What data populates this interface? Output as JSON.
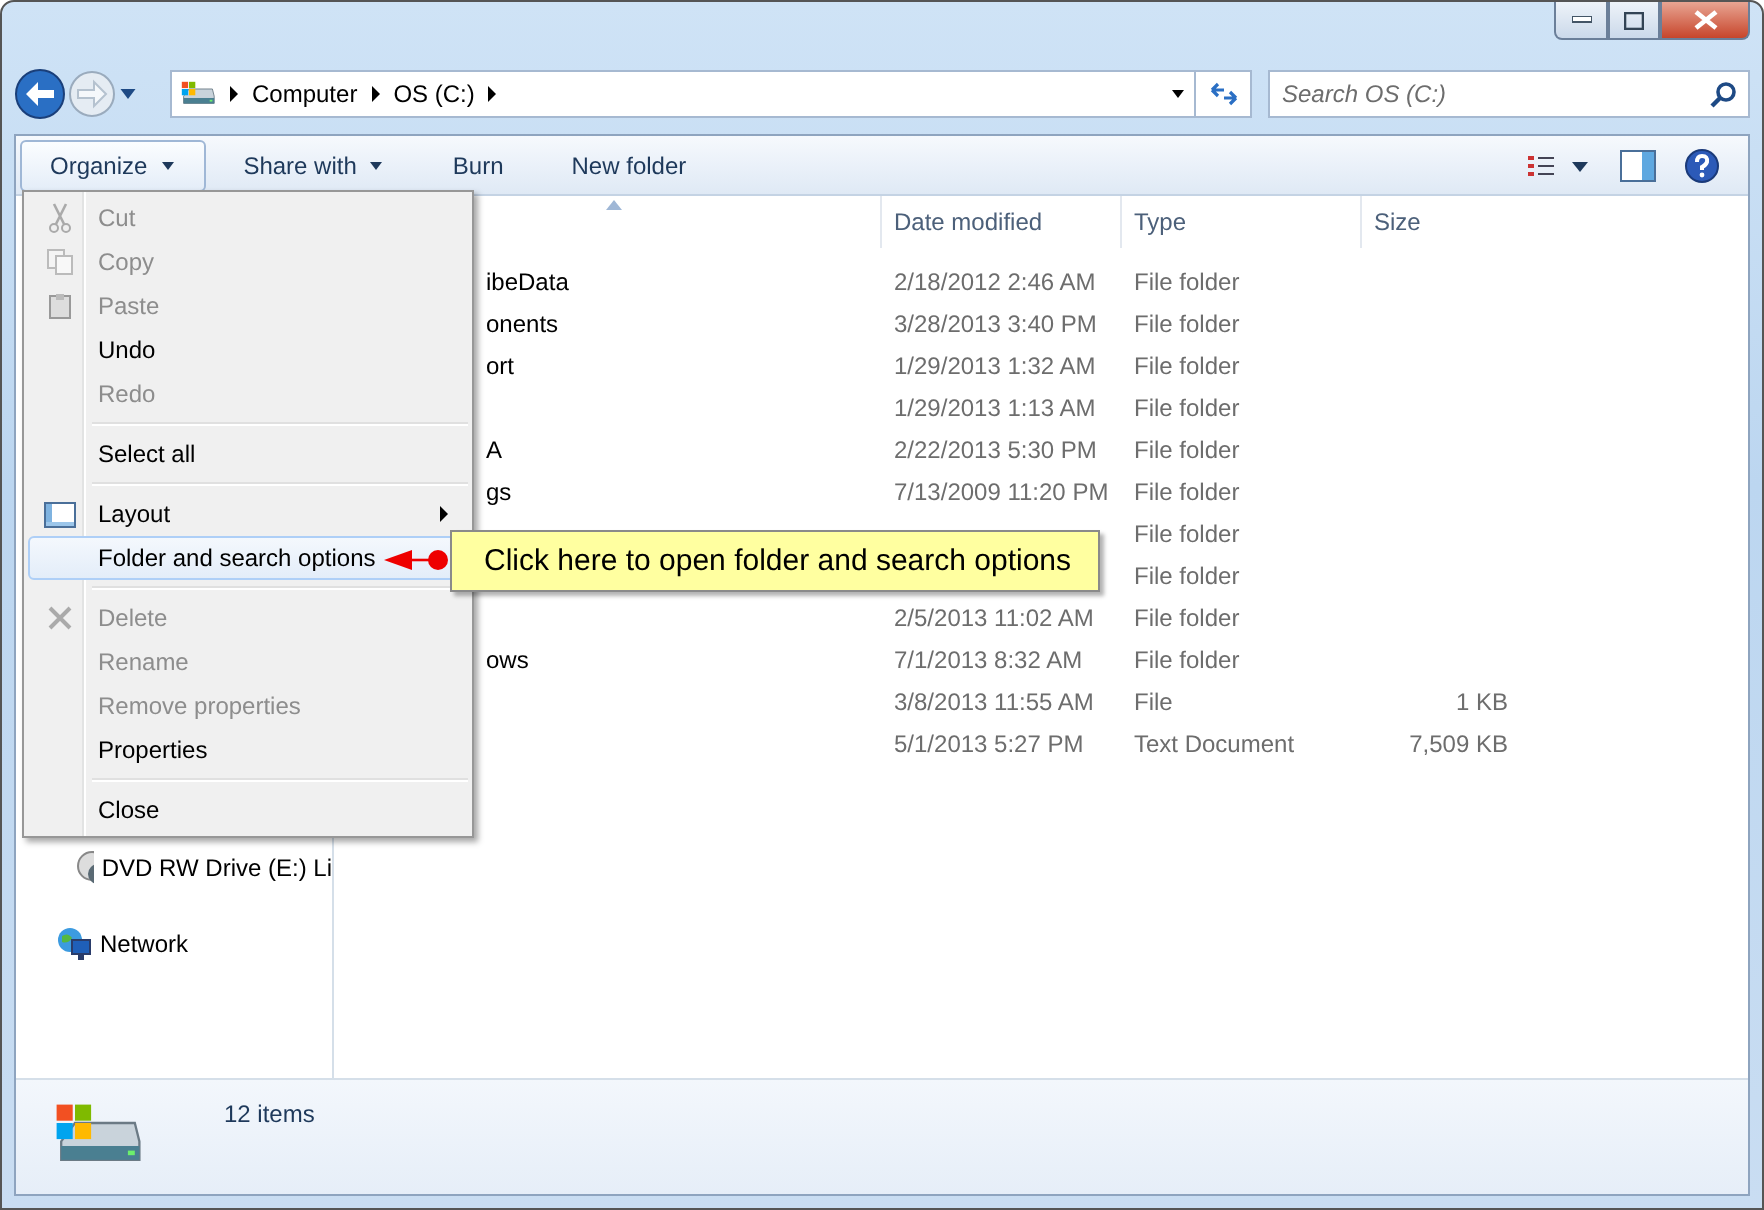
{
  "address_bar": {
    "crumbs": [
      "Computer",
      "OS (C:)"
    ]
  },
  "search": {
    "placeholder": "Search OS (C:)"
  },
  "toolbar": {
    "buttons": [
      {
        "label": "Organize",
        "dropdown": true,
        "selected": true
      },
      {
        "label": "Share with",
        "dropdown": true,
        "selected": false
      },
      {
        "label": "Burn",
        "dropdown": false,
        "selected": false
      },
      {
        "label": "New folder",
        "dropdown": false,
        "selected": false
      }
    ]
  },
  "table": {
    "columns": [
      "Date modified",
      "Type",
      "Size"
    ],
    "rows": [
      {
        "name": "ibeData",
        "date": "2/18/2012 2:46 AM",
        "type": "File folder"
      },
      {
        "name": "onents",
        "date": "3/28/2013 3:40 PM",
        "type": "File folder"
      },
      {
        "name": "ort",
        "date": "1/29/2013 1:32 AM",
        "type": "File folder"
      },
      {
        "date": "1/29/2013 1:13 AM",
        "type": "File folder"
      },
      {
        "name": "A",
        "date": "2/22/2013 5:30 PM",
        "type": "File folder"
      },
      {
        "name": "gs",
        "date": "7/13/2009 11:20 PM",
        "type": "File folder"
      },
      {
        "type": "File folder"
      },
      {
        "type": "File folder"
      },
      {
        "date": "2/5/2013 11:02 AM",
        "type": "File folder"
      },
      {
        "name": "ows",
        "date": "7/1/2013 8:32 AM",
        "type": "File folder"
      },
      {
        "date": "3/8/2013 11:55 AM",
        "type": "File",
        "size": "1 KB"
      },
      {
        "date": "5/1/2013 5:27 PM",
        "type": "Text Document",
        "size": "7,509 KB"
      }
    ]
  },
  "navigation": {
    "items": [
      {
        "label": "DVD RW Drive (E:) Li",
        "kind": "dvd"
      },
      {
        "label": "Network",
        "kind": "network"
      }
    ]
  },
  "menu": {
    "items": [
      {
        "kind": "item",
        "label": "Cut",
        "disabled": true,
        "selected": false
      },
      {
        "kind": "item",
        "label": "Copy",
        "disabled": true,
        "selected": false
      },
      {
        "kind": "item",
        "label": "Paste",
        "disabled": true,
        "selected": false
      },
      {
        "kind": "item",
        "label": "Undo",
        "disabled": false,
        "selected": false
      },
      {
        "kind": "item",
        "label": "Redo",
        "disabled": true,
        "selected": false
      },
      {
        "kind": "separator"
      },
      {
        "kind": "item",
        "label": "Select all",
        "disabled": false,
        "selected": false
      },
      {
        "kind": "separator"
      },
      {
        "kind": "item",
        "label": "Layout",
        "disabled": false,
        "submenu": true,
        "selected": false
      },
      {
        "kind": "item",
        "label": "Folder and search options",
        "disabled": false,
        "selected": true
      },
      {
        "kind": "separator"
      },
      {
        "kind": "item",
        "label": "Delete",
        "disabled": true,
        "selected": false
      },
      {
        "kind": "item",
        "label": "Rename",
        "disabled": true,
        "selected": false
      },
      {
        "kind": "item",
        "label": "Remove properties",
        "disabled": true,
        "selected": false
      },
      {
        "kind": "item",
        "label": "Properties",
        "disabled": false,
        "selected": false
      },
      {
        "kind": "separator"
      },
      {
        "kind": "item",
        "label": "Close",
        "disabled": false,
        "selected": false
      }
    ]
  },
  "callout": {
    "text": "Click here to open folder and search options"
  },
  "status_bar": {
    "text": "12 items"
  }
}
